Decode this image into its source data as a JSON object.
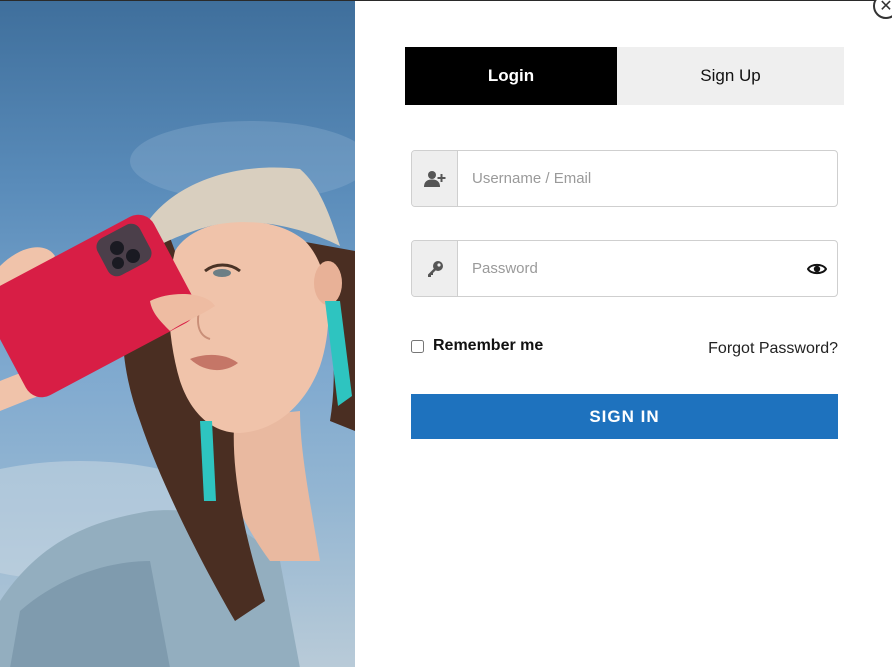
{
  "close": {
    "symbol": "✕"
  },
  "tabs": [
    {
      "label": "Login",
      "active": true
    },
    {
      "label": "Sign Up",
      "active": false
    }
  ],
  "form": {
    "username": {
      "placeholder": "Username / Email",
      "value": "",
      "icon": "user-plus-icon"
    },
    "password": {
      "placeholder": "Password",
      "value": "",
      "icon": "key-icon",
      "toggle_icon": "eye-icon"
    },
    "remember_label": "Remember me",
    "forgot_label": "Forgot Password?",
    "submit_label": "SIGN IN"
  },
  "colors": {
    "primary": "#1e72be",
    "active_tab": "#000000",
    "inactive_tab": "#efefef",
    "phone_case": "#d81e45",
    "earring": "#2ec4c0"
  }
}
